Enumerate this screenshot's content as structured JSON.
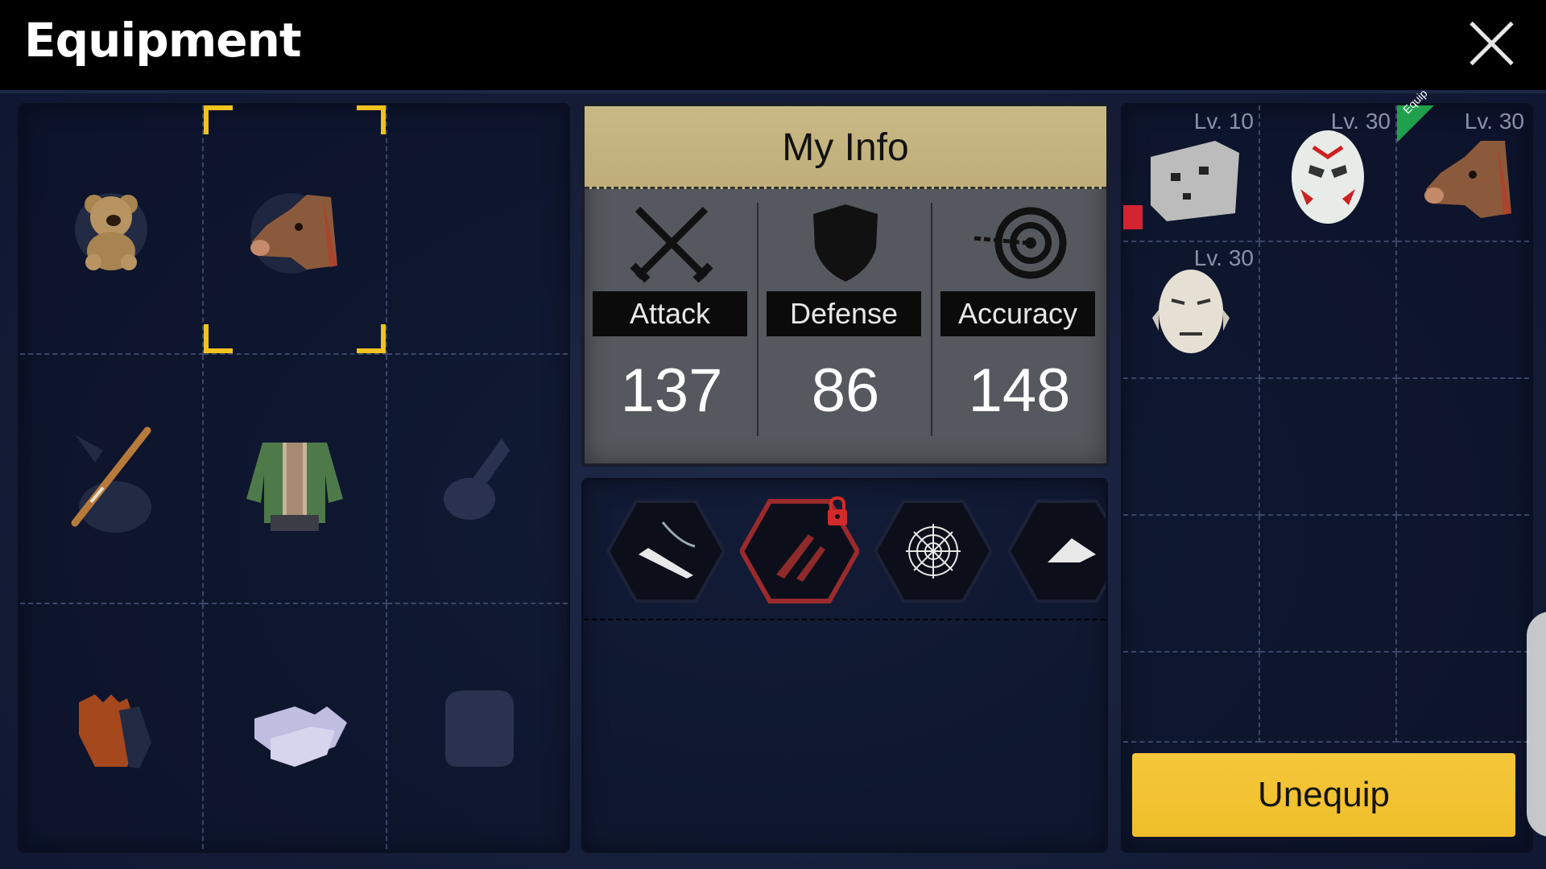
{
  "header": {
    "title": "Equipment"
  },
  "equipment": {
    "slots": [
      {
        "icon": "teddy-bear-icon"
      },
      {
        "icon": "horse-mask-icon",
        "selected": true
      },
      {
        "icon": "empty"
      },
      {
        "icon": "baseball-bat-icon"
      },
      {
        "icon": "jacket-icon"
      },
      {
        "icon": "empty-weapon-slot-icon"
      },
      {
        "icon": "gloves-icon"
      },
      {
        "icon": "shoes-icon"
      },
      {
        "icon": "empty-bag-slot-icon"
      }
    ]
  },
  "info": {
    "title": "My Info",
    "stats": [
      {
        "label": "Attack",
        "value": "137",
        "icon": "crossed-swords-icon"
      },
      {
        "label": "Defense",
        "value": "86",
        "icon": "shield-icon"
      },
      {
        "label": "Accuracy",
        "value": "148",
        "icon": "target-icon"
      }
    ]
  },
  "skills": [
    {
      "icon": "knife-slash-icon",
      "locked": false
    },
    {
      "icon": "throwing-knives-icon",
      "locked": true
    },
    {
      "icon": "spider-web-icon",
      "locked": false
    },
    {
      "icon": "spider-icon",
      "locked": false
    }
  ],
  "inventory": [
    {
      "level": "Lv. 10",
      "icon": "cardboard-mask-icon",
      "equipped": false,
      "red_tag": true
    },
    {
      "level": "Lv. 30",
      "icon": "hockey-mask-icon",
      "equipped": false
    },
    {
      "level": "Lv. 30",
      "icon": "horse-mask-icon",
      "equipped": true,
      "badge": "Equip"
    },
    {
      "level": "Lv. 30",
      "icon": "old-man-mask-icon",
      "equipped": false
    }
  ],
  "actions": {
    "unequip": "Unequip"
  },
  "colors": {
    "accent": "#f2c21e",
    "button": "#f0be2a",
    "header_tan": "#c9b985"
  }
}
